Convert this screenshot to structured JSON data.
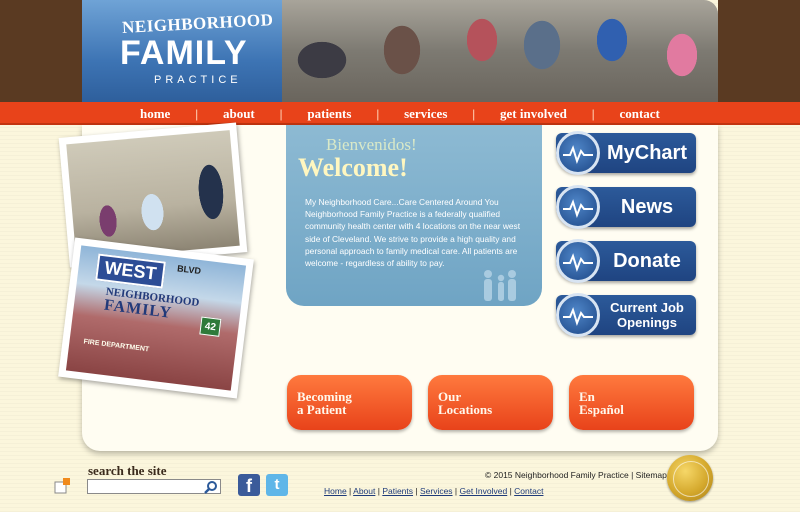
{
  "header": {
    "logo": {
      "line1": "NEIGHBORHOOD",
      "line2": "FAMILY",
      "line3": "PRACTICE"
    }
  },
  "nav": {
    "items": [
      {
        "label": "home"
      },
      {
        "label": "about"
      },
      {
        "label": "patients"
      },
      {
        "label": "services"
      },
      {
        "label": "get involved"
      },
      {
        "label": "contact"
      }
    ],
    "separator": "|"
  },
  "photos": {
    "mural": {
      "west": "WEST",
      "blvd": "BLVD",
      "nfp_top": "NEIGHBORHOOD",
      "nfp_main": "FAMILY",
      "route": "42",
      "fire": "FIRE DEPARTMENT"
    }
  },
  "welcome": {
    "spanish": "Bienvenidos!",
    "english": "Welcome!",
    "body": "My Neighborhood Care...Care Centered Around You Neighborhood Family Practice is a federally qualified community health center with 4 locations on the near west side of Cleveland. We strive to provide a high quality and personal approach to family medical care. All patients are welcome - regardless of ability to pay."
  },
  "side_buttons": [
    {
      "label": "MyChart"
    },
    {
      "label": "News"
    },
    {
      "label": "Donate"
    },
    {
      "label": "Current Job Openings"
    }
  ],
  "bottom_buttons": [
    {
      "line1": "Becoming",
      "line2": "a Patient"
    },
    {
      "line1": "Our",
      "line2": "Locations"
    },
    {
      "line1": "En",
      "line2": "Español"
    }
  ],
  "footer": {
    "search_label": "search the site",
    "search_placeholder": "",
    "facebook": "f",
    "twitter": "t",
    "copyright": "© 2015 Neighborhood Family Practice | Sitemap",
    "links": [
      "Home",
      "About",
      "Patients",
      "Services",
      "Get Involved",
      "Contact"
    ]
  },
  "colors": {
    "nav_orange": "#e8431a",
    "button_blue": "#1f4481",
    "welcome_blue": "#6fa4c4",
    "background_cream": "#fbf6dc"
  }
}
